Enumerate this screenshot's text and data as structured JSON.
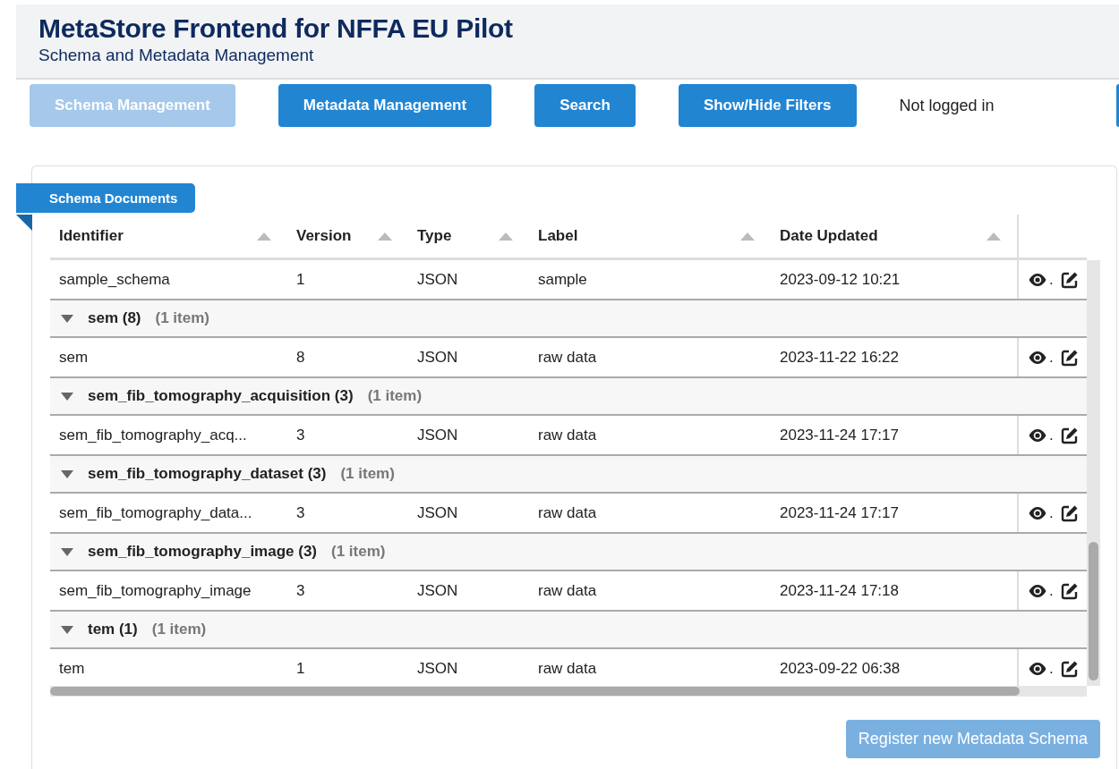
{
  "header": {
    "title": "MetaStore Frontend for NFFA EU Pilot",
    "subtitle": "Schema and Metadata Management"
  },
  "nav": {
    "buttons": [
      {
        "label": "Schema Management",
        "disabled": true
      },
      {
        "label": "Metadata Management",
        "disabled": false
      },
      {
        "label": "Search",
        "disabled": false
      },
      {
        "label": "Show/Hide Filters",
        "disabled": false
      }
    ],
    "login_status": "Not logged in"
  },
  "panel": {
    "tab": "Schema Documents",
    "table": {
      "columns": [
        "Identifier",
        "Version",
        "Type",
        "Label",
        "Date Updated"
      ],
      "rows": [
        {
          "kind": "data",
          "cells": [
            "sample_schema",
            "1",
            "JSON",
            "sample",
            "2023-09-12 10:21"
          ],
          "separator": "."
        },
        {
          "kind": "group",
          "expanded": true,
          "label": "sem (8)",
          "count": "(1 item)"
        },
        {
          "kind": "data",
          "cells": [
            "sem",
            "8",
            "JSON",
            "raw data",
            "2023-11-22 16:22"
          ],
          "separator": "."
        },
        {
          "kind": "group",
          "expanded": true,
          "label": "sem_fib_tomography_acquisition (3)",
          "count": "(1 item)"
        },
        {
          "kind": "data",
          "cells": [
            "sem_fib_tomography_acq...",
            "3",
            "JSON",
            "raw data",
            "2023-11-24 17:17"
          ],
          "separator": "."
        },
        {
          "kind": "group",
          "expanded": true,
          "label": "sem_fib_tomography_dataset (3)",
          "count": "(1 item)"
        },
        {
          "kind": "data",
          "cells": [
            "sem_fib_tomography_data...",
            "3",
            "JSON",
            "raw data",
            "2023-11-24 17:17"
          ],
          "separator": "."
        },
        {
          "kind": "group",
          "expanded": true,
          "label": "sem_fib_tomography_image (3)",
          "count": "(1 item)"
        },
        {
          "kind": "data",
          "cells": [
            "sem_fib_tomography_image",
            "3",
            "JSON",
            "raw data",
            "2023-11-24 17:18"
          ],
          "separator": "."
        },
        {
          "kind": "group",
          "expanded": true,
          "label": "tem (1)",
          "count": "(1 item)"
        },
        {
          "kind": "data",
          "cells": [
            "tem",
            "1",
            "JSON",
            "raw data",
            "2023-09-22 06:38"
          ],
          "separator": "."
        }
      ]
    },
    "register_button": {
      "label": "Register new Metadata Schema",
      "disabled": true
    }
  }
}
